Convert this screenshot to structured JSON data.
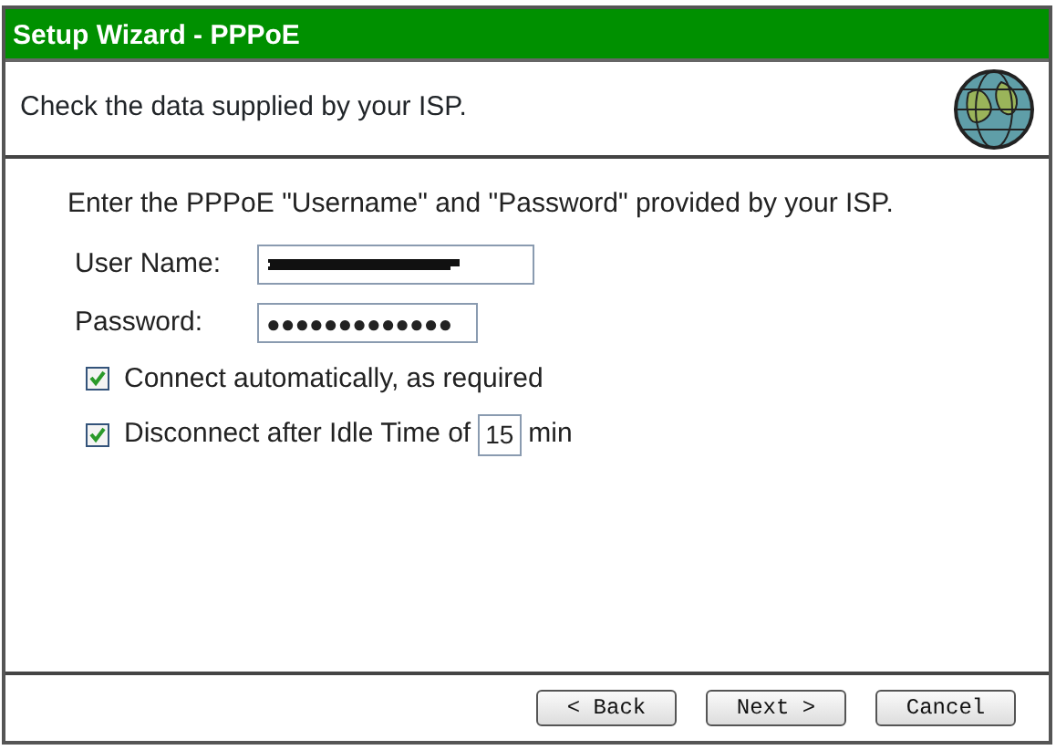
{
  "window": {
    "title": "Setup Wizard - PPPoE"
  },
  "header": {
    "text": "Check the data supplied by your ISP."
  },
  "instruction": "Enter the PPPoE \"Username\" and \"Password\" provided by your ISP.",
  "fields": [
    {
      "label": "User Name:",
      "kind": "redacted"
    },
    {
      "label": "Password:",
      "kind": "password",
      "value": "●●●●●●●●●●●●●"
    }
  ],
  "options": [
    {
      "label": "Connect automatically, as required",
      "checked": true
    },
    {
      "label": "Disconnect after Idle Time of",
      "checked": true,
      "input": "15",
      "suffix": "min"
    }
  ],
  "buttons": [
    "< Back",
    "Next >",
    "Cancel"
  ]
}
